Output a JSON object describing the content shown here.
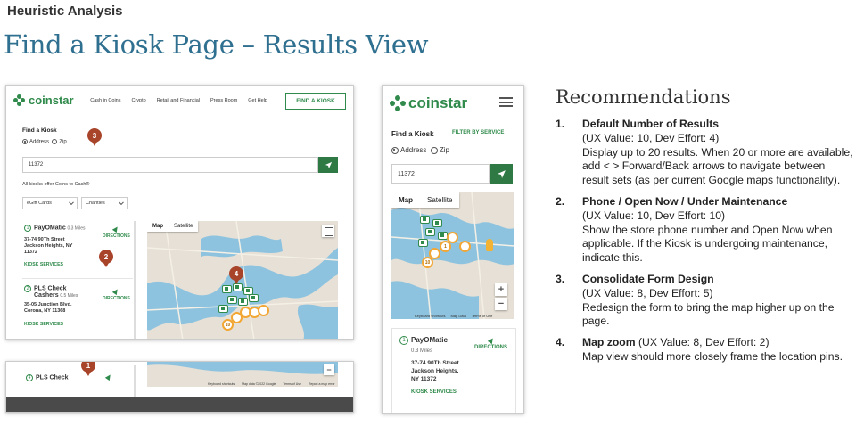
{
  "header": {
    "eyebrow": "Heuristic Analysis",
    "title": "Find a Kiosk Page – Results View"
  },
  "colors": {
    "brand_green": "#2f8a4b",
    "title_blue": "#2f6f8f",
    "badge": "#a8442a",
    "pin_ring": "#f2a735"
  },
  "desktop": {
    "logo": "coinstar",
    "nav": [
      "Cash in Coins",
      "Crypto",
      "Retail and Financial",
      "Press Room",
      "Get Help"
    ],
    "find_kiosk_button": "FIND A KIOSK",
    "find_label": "Find a Kiosk",
    "radio_address": "Address",
    "radio_zip": "Zip",
    "search_value": "11372",
    "notice": "All kiosks offer Coins to Cash®",
    "filter_1": "eGift Cards",
    "filter_2": "Charities",
    "results": [
      {
        "num": "1",
        "name": "PayOMatic",
        "distance": "0.3 Miles",
        "address_1": "37-74 90Th Street",
        "address_2": "Jackson Heights, NY",
        "address_3": "11372",
        "services": "KIOSK SERVICES",
        "directions": "DIRECTIONS"
      },
      {
        "num": "2",
        "name": "PLS Check",
        "name_2": "Cashers",
        "distance": "0.5 Miles",
        "address_1": "35-05 Junction Blvd.",
        "address_2": "Corona, NY 11368",
        "services": "KIOSK SERVICES",
        "directions": "DIRECTIONS"
      }
    ],
    "map_tabs": [
      "Map",
      "Satellite"
    ],
    "badges": [
      "3",
      "2",
      "4",
      "1"
    ],
    "cluster_labels": [
      "10"
    ],
    "second_view": {
      "result_num": "4",
      "result_name": "PLS Check",
      "map_footer": [
        "Keyboard shortcuts",
        "Map data ©2022 Google",
        "Terms of Use",
        "Report a map error"
      ]
    }
  },
  "mobile": {
    "logo": "coinstar",
    "find_label": "Find a Kiosk",
    "filter_label": "FILTER BY SERVICE",
    "radio_address": "Address",
    "radio_zip": "Zip",
    "search_value": "11372",
    "map_tabs": [
      "Map",
      "Satellite"
    ],
    "cluster_labels": [
      "1",
      "10"
    ],
    "map_footer": [
      "Keyboard shortcuts",
      "Map Data",
      "Terms of Use"
    ],
    "zoom_in": "+",
    "zoom_out": "−",
    "result": {
      "num": "1",
      "name": "PayOMatic",
      "distance": "0.3 Miles",
      "address_1": "37-74 90Th Street",
      "address_2": "Jackson Heights,",
      "address_3": "NY 11372",
      "services": "KIOSK SERVICES",
      "directions": "DIRECTIONS"
    }
  },
  "recommendations": {
    "title": "Recommendations",
    "items": [
      {
        "num": "1.",
        "heading": "Default Number of Results",
        "value": "(UX Value: 10, Dev Effort: 4)",
        "body": "Display up to 20 results. When 20 or more are available, add < > Forward/Back arrows to navigate between result sets (as per current Google maps functionality)."
      },
      {
        "num": "2.",
        "heading": "Phone / Open Now / Under Maintenance",
        "value": "(UX Value: 10, Dev Effort: 10)",
        "body": "Show the store phone number and Open Now when applicable. If the Kiosk is undergoing maintenance, indicate this."
      },
      {
        "num": "3.",
        "heading": "Consolidate Form Design",
        "value": "(UX Value: 8, Dev Effort: 5)",
        "body": "Redesign the form to bring the map higher up on the page."
      },
      {
        "num": "4.",
        "heading": "Map zoom",
        "value": "(UX Value: 8, Dev Effort: 2)",
        "body": "Map view should more closely frame the location pins."
      }
    ]
  }
}
